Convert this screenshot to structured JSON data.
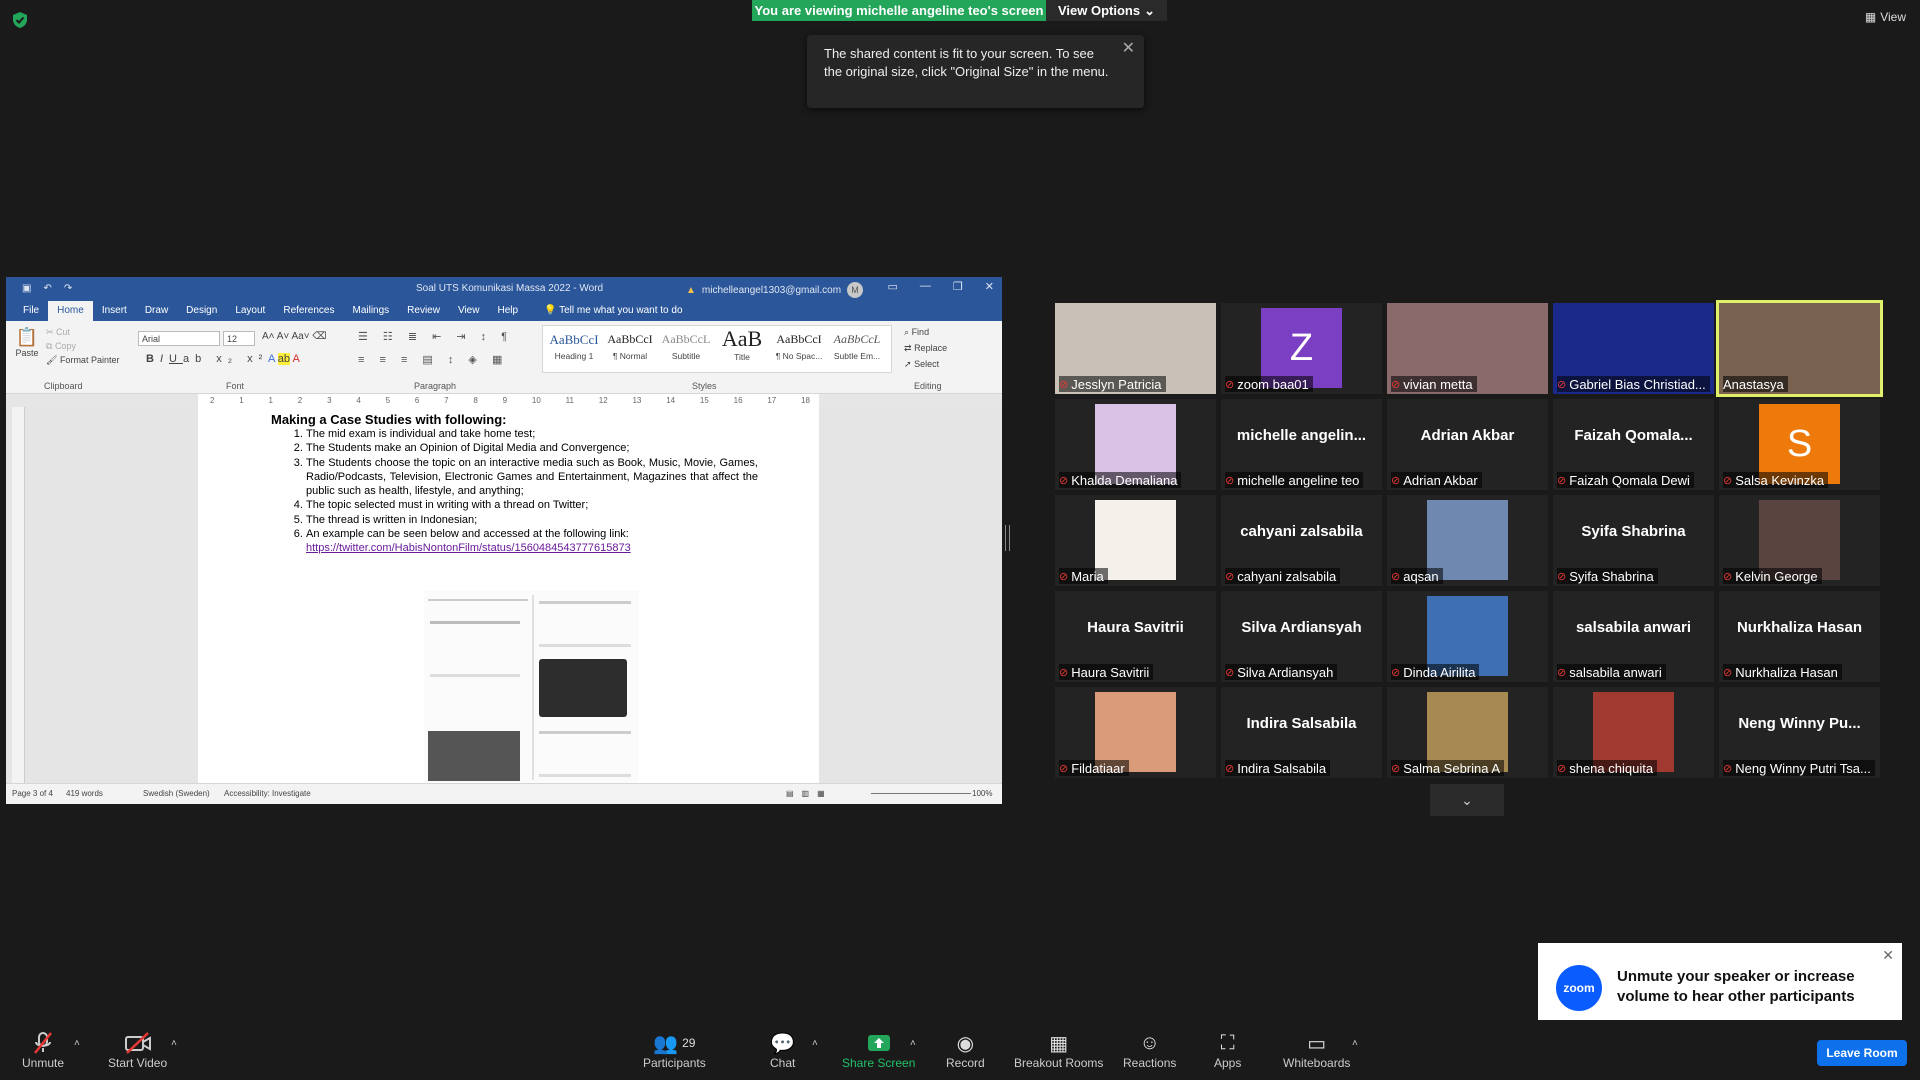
{
  "top": {
    "viewing_banner": "You are viewing michelle angeline teo's screen",
    "view_options": "View Options",
    "view_button": "View",
    "tooltip": "The shared content is fit to your screen. To see the original size, click \"Original Size\" in the menu."
  },
  "word": {
    "doc_title": "Soal UTS Komunikasi Massa 2022  -  Word",
    "account": "michelleangel1303@gmail.com",
    "account_initial": "M",
    "tabs": [
      "File",
      "Home",
      "Insert",
      "Draw",
      "Design",
      "Layout",
      "References",
      "Mailings",
      "Review",
      "View",
      "Help"
    ],
    "tell_me": "Tell me what you want to do",
    "clipboard": {
      "paste": "Paste",
      "cut": "Cut",
      "copy": "Copy",
      "format_painter": "Format Painter",
      "label": "Clipboard"
    },
    "font": {
      "name": "Arial",
      "size": "12",
      "label": "Font"
    },
    "paragraph_label": "Paragraph",
    "styles": [
      {
        "preview": "AaBbCcI",
        "name": "Heading 1"
      },
      {
        "preview": "AaBbCcI",
        "name": "¶ Normal"
      },
      {
        "preview": "AaBbCcL",
        "name": "Subtitle"
      },
      {
        "preview": "AaB",
        "name": "Title"
      },
      {
        "preview": "AaBbCcI",
        "name": "¶ No Spac..."
      },
      {
        "preview": "AaBbCcL",
        "name": "Subtle Em..."
      }
    ],
    "styles_label": "Styles",
    "editing": {
      "find": "Find",
      "replace": "Replace",
      "select": "Select",
      "label": "Editing"
    },
    "ruler_marks": [
      "2",
      "1",
      "1",
      "2",
      "3",
      "4",
      "5",
      "6",
      "7",
      "8",
      "9",
      "10",
      "11",
      "12",
      "13",
      "14",
      "15",
      "16",
      "17",
      "18"
    ],
    "heading": "Making a Case Studies with following:",
    "items": [
      "The mid exam is individual and take home test;",
      "The Students make an Opinion of Digital Media and Convergence;",
      "The Students choose the topic on an interactive media such as Book, Music, Movie, Games, Radio/Podcasts, Television, Electronic Games and Entertainment, Magazines that affect the public such as health, lifestyle, and anything;",
      "The topic selected must in writing with a thread on Twitter;",
      "The thread is written in Indonesian;",
      "An example can be seen below and accessed at the following link:"
    ],
    "link": "https://twitter.com/HabisNontonFilm/status/1560484543777615873",
    "status": {
      "page": "Page 3 of 4",
      "words": "419 words",
      "lang": "Swedish (Sweden)",
      "access": "Accessibility: Investigate",
      "zoom": "100%"
    }
  },
  "participants": [
    {
      "name": "Jesslyn Patricia",
      "kind": "photo",
      "color": "#c9c0b8",
      "highlight": false
    },
    {
      "name": "zoom baa01",
      "kind": "letter",
      "letter": "Z",
      "color": "#7b3fc4",
      "highlight": false
    },
    {
      "name": "vivian metta",
      "kind": "photo",
      "color": "#8a6a6a",
      "highlight": false
    },
    {
      "name": "Gabriel Bias Christiad...",
      "kind": "photo",
      "color": "#1b2a8a",
      "highlight": false
    },
    {
      "name": "Anastasya",
      "kind": "photo",
      "color": "#7a6250",
      "highlight": true
    },
    {
      "name": "Khalda Demaliana",
      "kind": "photo",
      "color": "#d9c2e6",
      "highlight": false
    },
    {
      "name": "michelle angeline teo",
      "kind": "text",
      "big": "michelle angelin...",
      "highlight": false
    },
    {
      "name": "Adrian Akbar",
      "kind": "text",
      "big": "Adrian Akbar",
      "highlight": false
    },
    {
      "name": "Faizah Qomala Dewi",
      "kind": "text",
      "big": "Faizah Qomala...",
      "highlight": false
    },
    {
      "name": "Salsa Kevinzka",
      "kind": "letter",
      "letter": "S",
      "color": "#ee7a0c",
      "highlight": false
    },
    {
      "name": "Maria",
      "kind": "photo",
      "color": "#f4f0ea",
      "highlight": false
    },
    {
      "name": "cahyani zalsabila",
      "kind": "text",
      "big": "cahyani zalsabila",
      "highlight": false
    },
    {
      "name": "aqsan",
      "kind": "photo",
      "color": "#6f88b0",
      "highlight": false
    },
    {
      "name": "Syifa Shabrina",
      "kind": "text",
      "big": "Syifa Shabrina",
      "highlight": false
    },
    {
      "name": "Kelvin George",
      "kind": "photo",
      "color": "#5a4440",
      "highlight": false
    },
    {
      "name": "Haura Savitrii",
      "kind": "text",
      "big": "Haura Savitrii",
      "highlight": false
    },
    {
      "name": "Silva Ardiansyah",
      "kind": "text",
      "big": "Silva Ardiansyah",
      "highlight": false
    },
    {
      "name": "Dinda Airilita",
      "kind": "photo",
      "color": "#3f6fb3",
      "highlight": false
    },
    {
      "name": "salsabila anwari",
      "kind": "text",
      "big": "salsabila anwari",
      "highlight": false
    },
    {
      "name": "Nurkhaliza Hasan",
      "kind": "text",
      "big": "Nurkhaliza Hasan",
      "highlight": false
    },
    {
      "name": "Fildatiaar",
      "kind": "photo",
      "color": "#d99b78",
      "highlight": false
    },
    {
      "name": "Indira Salsabila",
      "kind": "text",
      "big": "Indira Salsabila",
      "highlight": false
    },
    {
      "name": "Salma Sebrina A",
      "kind": "photo",
      "color": "#a68a52",
      "highlight": false
    },
    {
      "name": "shena chiquita",
      "kind": "photo",
      "color": "#a03a30",
      "highlight": false
    },
    {
      "name": "Neng Winny Putri Tsa...",
      "kind": "text",
      "big": "Neng Winny Pu...",
      "highlight": false
    }
  ],
  "toast": {
    "logo": "zoom",
    "message": "Unmute your speaker or increase volume to hear other participants"
  },
  "toolbar": {
    "unmute": "Unmute",
    "start_video": "Start Video",
    "participants": "Participants",
    "participants_count": "29",
    "chat": "Chat",
    "share_screen": "Share Screen",
    "record": "Record",
    "breakout": "Breakout Rooms",
    "reactions": "Reactions",
    "apps": "Apps",
    "whiteboards": "Whiteboards",
    "leave": "Leave Room"
  }
}
